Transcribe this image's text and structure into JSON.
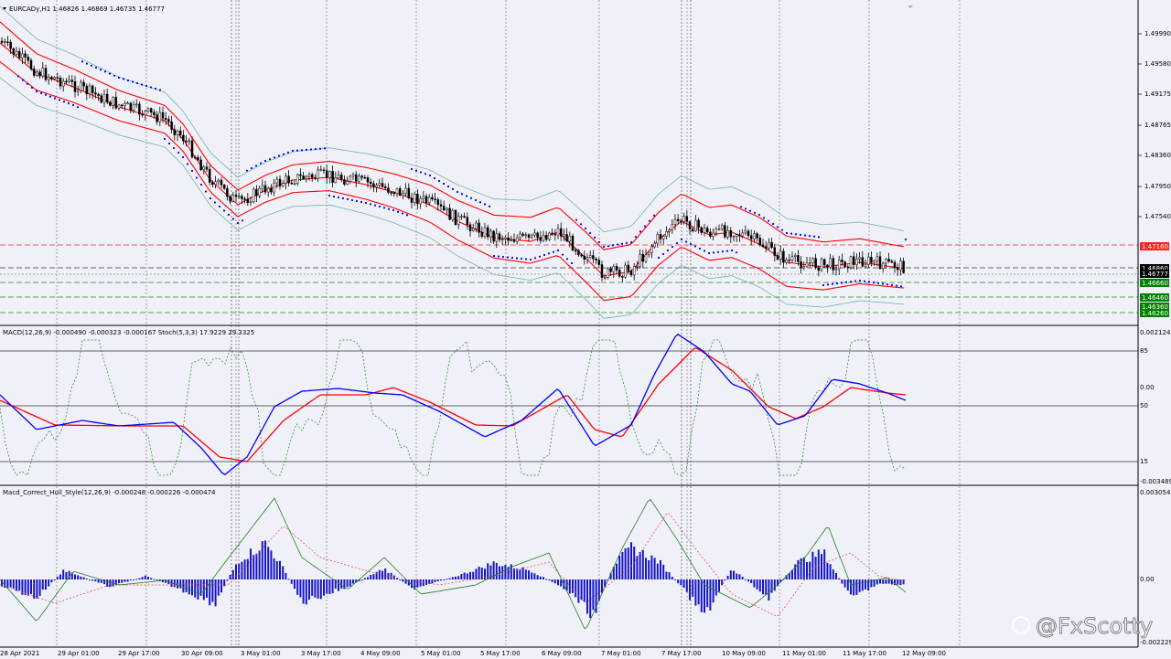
{
  "main": {
    "title": "EURCADy,H1  1.46826 1.46869 1.46735 1.46777",
    "price_labels": [
      "1.49990",
      "1.49580",
      "1.49175",
      "1.48765",
      "1.48360",
      "1.47950",
      "1.47540"
    ],
    "tags": [
      {
        "text": "1.47160",
        "color": "#ff2020",
        "price": 1.4716
      },
      {
        "text": "1.46860",
        "color": "#000000",
        "price": 1.4686
      },
      {
        "text": "1.46777",
        "color": "#000000",
        "price": 1.46777
      },
      {
        "text": "1.46660",
        "color": "#008000",
        "price": 1.4666
      },
      {
        "text": "1.46460",
        "color": "#008000",
        "price": 1.4646
      },
      {
        "text": "1.46360",
        "color": "#008000",
        "price": 1.4636
      },
      {
        "text": "1.46260",
        "color": "#008000",
        "price": 1.4626
      }
    ]
  },
  "sub1": {
    "title": "MACD(12,26,9) -0.000490 -0.000323 -0.000167  Stoch(5,3,3) 17.9229 29.3325",
    "axis_labels": [
      "0.002124",
      "85",
      "0.00",
      "50",
      "15",
      "-0.003489"
    ]
  },
  "sub2": {
    "title": "Macd_Correct_Hull_Style(12,26,9) -0.000248 -0.000226 -0.000474",
    "axis_labels": [
      "0.003054",
      "0.00",
      "-0.002229"
    ]
  },
  "time_labels": [
    "28 Apr 2021",
    "29 Apr 01:00",
    "29 Apr 17:00",
    "30 Apr 09:00",
    "3 May 01:00",
    "3 May 17:00",
    "4 May 09:00",
    "5 May 01:00",
    "5 May 17:00",
    "6 May 09:00",
    "7 May 01:00",
    "7 May 17:00",
    "10 May 09:00",
    "11 May 01:00",
    "11 May 17:00",
    "12 May 09:00"
  ],
  "watermark": "@FxScotty",
  "colors": {
    "bg": "#f0f0f8",
    "grid": "#808080",
    "macd": "#0000ff",
    "signal": "#ff0000",
    "bb": "#ff0000",
    "env": "#70b89a",
    "sar": "#0000ff",
    "stoch": "#208020",
    "hist": "#1515c8"
  }
}
